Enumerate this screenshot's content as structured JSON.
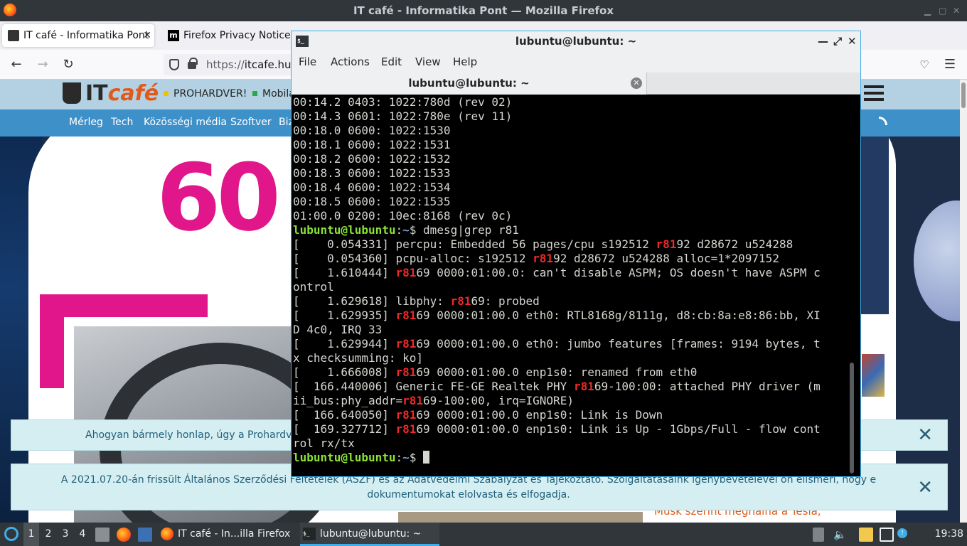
{
  "firefox": {
    "window_title": "IT café - Informatika Pont — Mozilla Firefox",
    "tabs": [
      {
        "label": "IT café - Informatika Pont"
      },
      {
        "label": "Firefox Privacy Notice"
      }
    ],
    "url_prefix": "https://",
    "url_host": "itcafe.hu/"
  },
  "site": {
    "logo_text": "IT",
    "logo_accent": "café",
    "header_links": [
      "PROHARDVER!",
      "Mobila"
    ],
    "nav_items": [
      "Mérleg",
      "Tech",
      "Közösségi média",
      "Szoftver",
      "Biz"
    ],
    "hero_number": "60",
    "headline": "Musk szerint meghalna a Tesla,"
  },
  "banners": {
    "cookie_text": "Ahogyan bármely honlap, úgy a Prohardver lap",
    "terms_text": "A 2021.07.20-án frissült Általános Szerződési Feltételek (ÁSZF) és az Adatvédelmi Szabályzat és Tájékoztató. Szolgáltatásaink igénybevételével ön elismeri, hogy e dokumentumokat elolvasta és elfogadja.",
    "close_glyph": "✕"
  },
  "terminal": {
    "window_title": "lubuntu@lubuntu: ~",
    "menu": [
      "File",
      "Actions",
      "Edit",
      "View",
      "Help"
    ],
    "tab_label": "lubuntu@lubuntu: ~",
    "prompt_user": "lubuntu@lubuntu",
    "prompt_sep": ":",
    "prompt_path": "~",
    "prompt_sym": "$ ",
    "command": "dmesg|grep r81",
    "pre_lines": [
      "00:14.2 0403: 1022:780d (rev 02)",
      "00:14.3 0601: 1022:780e (rev 11)",
      "00:18.0 0600: 1022:1530",
      "00:18.1 0600: 1022:1531",
      "00:18.2 0600: 1022:1532",
      "00:18.3 0600: 1022:1533",
      "00:18.4 0600: 1022:1534",
      "00:18.5 0600: 1022:1535",
      "01:00.0 0200: 10ec:8168 (rev 0c)"
    ],
    "output_lines": [
      {
        "a": "[    0.054331] percpu: Embedded 56 pages/cpu s192512 ",
        "h": "r81",
        "b": "92 d28672 u524288"
      },
      {
        "a": "[    0.054360] pcpu-alloc: s192512 ",
        "h": "r81",
        "b": "92 d28672 u524288 alloc=1*2097152"
      },
      {
        "a": "[    1.610444] ",
        "h": "r81",
        "b": "69 0000:01:00.0: can't disable ASPM; OS doesn't have ASPM c"
      },
      {
        "a": "ontrol",
        "h": "",
        "b": ""
      },
      {
        "a": "[    1.629618] libphy: ",
        "h": "r81",
        "b": "69: probed"
      },
      {
        "a": "[    1.629935] ",
        "h": "r81",
        "b": "69 0000:01:00.0 eth0: RTL8168g/8111g, d8:cb:8a:e8:86:bb, XI"
      },
      {
        "a": "D 4c0, IRQ 33",
        "h": "",
        "b": ""
      },
      {
        "a": "[    1.629944] ",
        "h": "r81",
        "b": "69 0000:01:00.0 eth0: jumbo features [frames: 9194 bytes, t"
      },
      {
        "a": "x checksumming: ko]",
        "h": "",
        "b": ""
      },
      {
        "a": "[    1.666008] ",
        "h": "r81",
        "b": "69 0000:01:00.0 enp1s0: renamed from eth0"
      },
      {
        "a": "[  166.440006] Generic FE-GE Realtek PHY ",
        "h": "r81",
        "b": "69-100:00: attached PHY driver (m"
      },
      {
        "a": "ii_bus:phy_addr=",
        "h": "r81",
        "b": "69-100:00, irq=IGNORE)"
      },
      {
        "a": "[  166.640050] ",
        "h": "r81",
        "b": "69 0000:01:00.0 enp1s0: Link is Down"
      },
      {
        "a": "[  169.327712] ",
        "h": "r81",
        "b": "69 0000:01:00.0 enp1s0: Link is Up - 1Gbps/Full - flow cont"
      },
      {
        "a": "rol rx/tx",
        "h": "",
        "b": ""
      }
    ]
  },
  "taskbar": {
    "desktops": [
      "1",
      "2",
      "3",
      "4"
    ],
    "tasks": [
      {
        "label": "IT café - In...illa Firefox"
      },
      {
        "label": "lubuntu@lubuntu: ~"
      }
    ],
    "clock": "19:38"
  },
  "colors": {
    "accent": "#3daee9",
    "brand_pink": "#e1168a",
    "brand_orange": "#e05a19",
    "match_red": "#ef2929",
    "prompt_green": "#8ae234",
    "prompt_blue": "#729fcf"
  }
}
